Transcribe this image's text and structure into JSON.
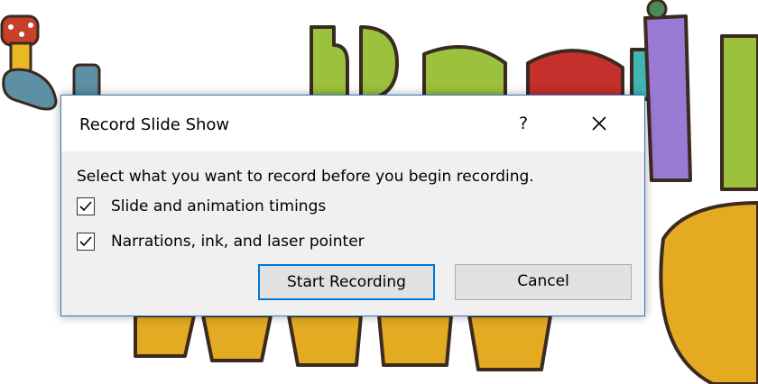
{
  "dialog": {
    "title": "Record Slide Show",
    "help_label": "?",
    "prompt": "Select what you want to record before you begin recording.",
    "options": [
      {
        "label": "Slide and animation timings",
        "checked": true
      },
      {
        "label": "Narrations, ink, and laser pointer",
        "checked": true
      }
    ],
    "start_button": "Start Recording",
    "cancel_button": "Cancel"
  },
  "icons": {
    "close": "close-icon",
    "check": "checkmark-icon"
  },
  "colors": {
    "dialog_border": "#3b78c4",
    "default_button_border": "#0078d7",
    "dialog_face": "#f0f0f0"
  }
}
